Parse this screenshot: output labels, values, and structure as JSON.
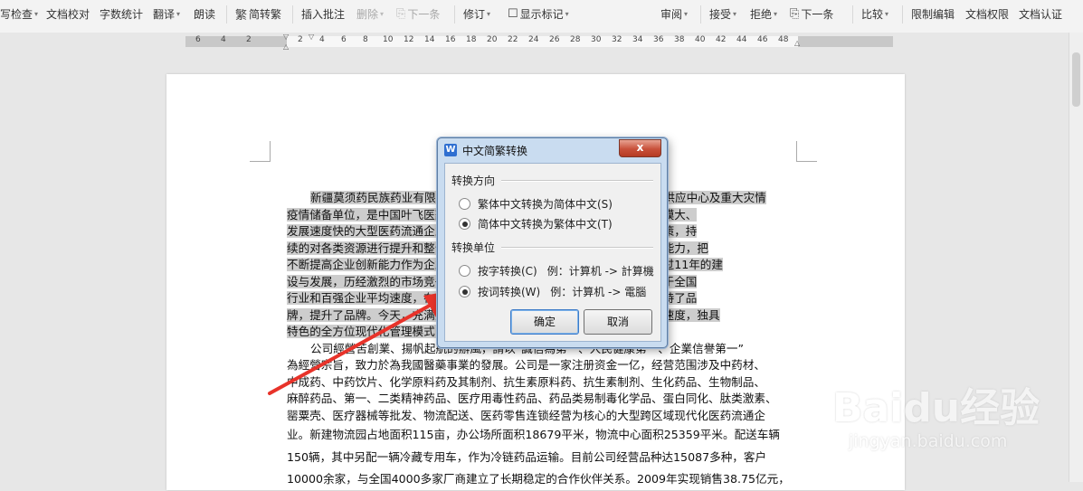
{
  "toolbar": {
    "spell_check": "写检查",
    "doc_proofread": "文档校对",
    "word_count": "字数统计",
    "translate": "翻译",
    "read_aloud": "朗读",
    "convert": "简转繁",
    "insert_comment": "插入批注",
    "delete": "删除",
    "next": "下一条",
    "revise": "修订",
    "show_markup": "显示标记",
    "review": "审阅",
    "accept": "接受",
    "reject": "拒绝",
    "next2": "下一条",
    "compare": "比较",
    "restrict_edit": "限制编辑",
    "doc_permission": "文档权限",
    "doc_certify": "文档认证"
  },
  "ruler": {
    "left_numbers": [
      "6",
      "4",
      "2"
    ],
    "right_numbers": [
      "2",
      "4",
      "6",
      "8",
      "10",
      "12",
      "14",
      "16",
      "18",
      "20",
      "22",
      "24",
      "26",
      "28",
      "30",
      "32",
      "34",
      "36",
      "38",
      "40",
      "42",
      "44",
      "46",
      "48"
    ]
  },
  "document": {
    "lines": [
      "新疆莫须药民族药业有限公司（原名新疆莫须药民族药业）是新疆药品供应中心及重大灾情",
      "疫情储备单位，是中国叶飞医药集团公司在疆重要经营企业，是西北地区规模大、",
      "发展速度快的大型医药流通企业。公司秉承领导层前瞻的发展战略和科学决策，持",
      "续的对各类资源进行提升和整合，不断强化内部管理，提升企业的核心竞争能力，把",
      "不断提高企业创新能力作为企业发展的核心，向着更高的目标向前发展。经过11年的建",
      "设与发展，历经激烈的市场竞争和严峻考验，企业稳步发展，发展速度均高于全国",
      "行业和百强企业平均速度，在以质量为核心的经营理念中，创造了品牌，保持了品",
      "牌，提升了品牌。今天，充满活力的企业凭借完善的网络，敏捷的市场反应速度，独具",
      "特色的全方位现代化管理模式，正在向更高的目标迈进，续写着辉煌。",
      "公司經營苦創業、揚帆起航的辦風，請以“誠信為第一、人民健康第一、企業信譽第一”",
      "為經營宗旨，致力於為我國醫藥事業的發展。公司是一家注册资金一亿，经营范围涉及中药材、",
      "中成药、中药饮片、化学原料药及其制剂、抗生素原料药、抗生素制剂、生化药品、生物制品、",
      "麻醉药品、第一、二类精神药品、医疗用毒性药品、药品类易制毒化学品、蛋白同化、肽类激素、",
      "罂粟壳、医疗器械等批发、物流配送、医药零售连锁经营为核心的大型跨区域现代化医药流通企",
      "业。新建物流园占地面积115亩，办公场所面积18679平米，物流中心面积25359平米。配送车辆",
      "150辆，其中另配一辆冷藏专用车，作为冷链药品运输。目前公司经营品种达15087多种，客户",
      "10000余家，与全国4000多家厂商建立了长期稳定的合作伙伴关系。2009年实现销售38.75亿元，"
    ]
  },
  "dialog": {
    "title": "中文简繁转换",
    "close": "x",
    "group1_title": "转换方向",
    "opt_trad_to_simp": "繁体中文转换为简体中文(S)",
    "opt_simp_to_trad": "简体中文转换为繁体中文(T)",
    "group2_title": "转换单位",
    "opt_by_char": "按字转换(C)",
    "opt_by_char_example": "例：计算机 -> 計算機",
    "opt_by_word": "按词转换(W)",
    "opt_by_word_example": "例：计算机 -> 電腦",
    "ok": "确定",
    "cancel": "取消"
  },
  "watermark": {
    "logo": "Baidu经验",
    "url": "jingyan.baidu.com"
  },
  "colors": {
    "arrow": "#e8332a",
    "selection": "#cdcdcd",
    "dialog_frame": "#c9dcf0",
    "close_button": "#c8503a"
  }
}
